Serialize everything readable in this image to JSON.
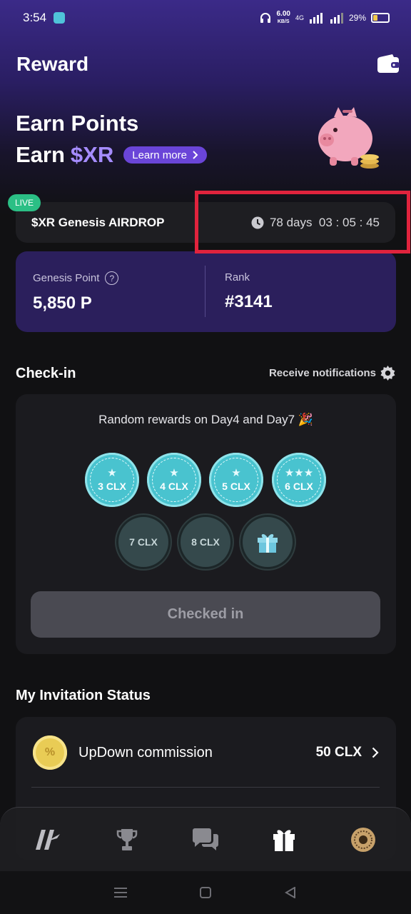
{
  "status_bar": {
    "time": "3:54",
    "net_speed": "6.00",
    "net_unit": "KB/S",
    "network": "4G",
    "battery": "29%"
  },
  "header": {
    "title": "Reward",
    "wallet_icon": "wallet-icon"
  },
  "hero": {
    "line1": "Earn Points",
    "line2_prefix": "Earn",
    "line2_token": "$XR",
    "learn_more": "Learn more",
    "accent": "#a58cff"
  },
  "airdrop": {
    "live": "LIVE",
    "title": "$XR Genesis AIRDROP",
    "countdown": "78 days  03 : 05 : 45"
  },
  "points": {
    "genesis_label": "Genesis Point",
    "genesis_value": "5,850 P",
    "rank_label": "Rank",
    "rank_value": "#3141"
  },
  "checkin": {
    "title": "Check-in",
    "notifications": "Receive notifications",
    "random_text": "Random rewards on Day4 and Day7 🎉",
    "days": [
      {
        "label": "3 CLX",
        "status": "done",
        "stars": 1
      },
      {
        "label": "4 CLX",
        "status": "done",
        "stars": 1
      },
      {
        "label": "5 CLX",
        "status": "done",
        "stars": 1
      },
      {
        "label": "6 CLX",
        "status": "done",
        "stars": 3
      },
      {
        "label": "7 CLX",
        "status": "pending"
      },
      {
        "label": "8 CLX",
        "status": "pending"
      },
      {
        "label": "",
        "status": "pending",
        "icon": "gift-icon"
      }
    ],
    "button": "Checked in"
  },
  "invitation": {
    "title": "My Invitation Status",
    "row_label": "UpDown commission",
    "row_value": "50 CLX",
    "coin_symbol": "%"
  },
  "bottom_nav": [
    "home-logo-icon",
    "trophy-icon",
    "chat-icon",
    "gift-icon",
    "profile-avatar"
  ],
  "colors": {
    "primary": "#6a45d8",
    "card_purple": "#2b1f5c",
    "teal": "#49c3cf",
    "live_green": "#2bbf85",
    "highlight_red": "#e0233d"
  }
}
